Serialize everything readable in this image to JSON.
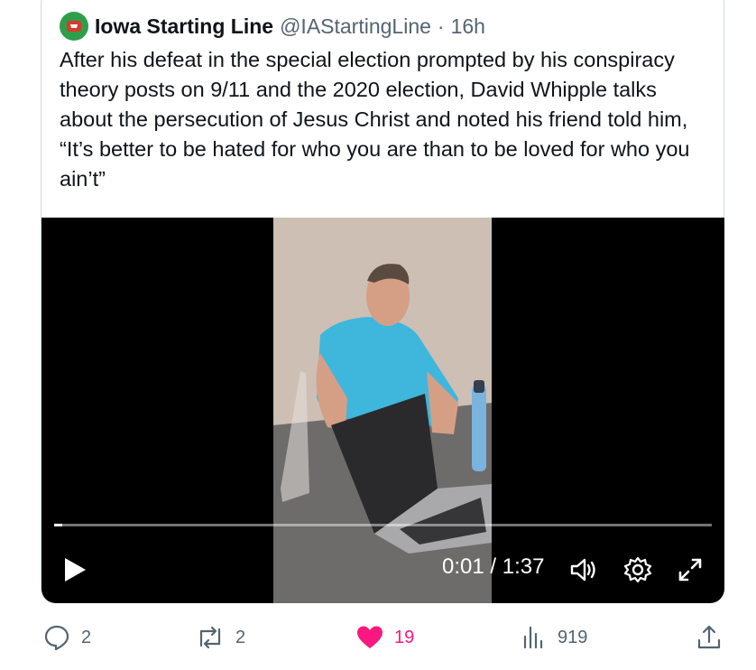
{
  "tweet": {
    "author": {
      "display_name": "Iowa Starting Line",
      "handle": "@IAStartingLine",
      "separator": "·",
      "time": "16h",
      "avatar_color": "#2f9e4b"
    },
    "text": "After his defeat in the special election prompted by his conspiracy theory posts on 9/11 and the 2020 election, David Whipple talks about the persecution of Jesus Christ and noted his friend told him, “It’s better to be hated for who you are than to be loved for who you ain’t”"
  },
  "video": {
    "time_display": "0:01 / 1:37",
    "progress": 0.01,
    "icons": [
      "play-icon",
      "volume-icon",
      "settings-icon",
      "fullscreen-icon"
    ]
  },
  "actions": {
    "replies": "2",
    "reposts": "2",
    "likes": "19",
    "views": "919",
    "like_color": "#f91880"
  }
}
